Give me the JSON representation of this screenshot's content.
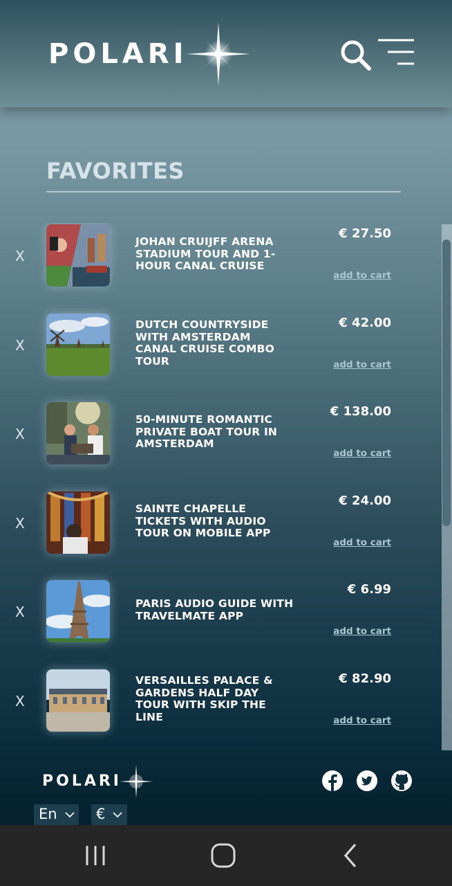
{
  "header": {
    "logo_text": "POLARI",
    "search_icon": "search-icon",
    "menu_icon": "hamburger-menu-icon"
  },
  "page": {
    "title": "FAVORITES"
  },
  "favorites": [
    {
      "remove": "X",
      "title": "JOHAN CRUIJFF ARENA STADIUM TOUR AND 1-HOUR CANAL CRUISE",
      "price": "€ 27.50",
      "cta": "add to cart"
    },
    {
      "remove": "X",
      "title": "DUTCH COUNTRYSIDE WITH AMSTERDAM CANAL CRUISE COMBO TOUR",
      "price": "€ 42.00",
      "cta": "add to cart"
    },
    {
      "remove": "X",
      "title": "50-MINUTE ROMANTIC PRIVATE BOAT TOUR IN AMSTERDAM",
      "price": "€ 138.00",
      "cta": "add to cart"
    },
    {
      "remove": "X",
      "title": "SAINTE CHAPELLE TICKETS WITH AUDIO TOUR ON MOBILE APP",
      "price": "€ 24.00",
      "cta": "add to cart"
    },
    {
      "remove": "X",
      "title": "PARIS AUDIO GUIDE WITH TRAVELMATE APP",
      "price": "€ 6.99",
      "cta": "add to cart"
    },
    {
      "remove": "X",
      "title": "VERSAILLES PALACE & GARDENS HALF DAY TOUR WITH SKIP THE LINE",
      "price": "€ 82.90",
      "cta": "add to cart"
    }
  ],
  "footer": {
    "logo_text": "POLARI",
    "social_icons": [
      "facebook-icon",
      "twitter-icon",
      "github-icon"
    ],
    "language": "En",
    "currency": "€"
  },
  "colors": {
    "accent_link": "#a9c6d2",
    "header_bg": "#56767f",
    "footer_select_bg": "#1c3e4e"
  }
}
